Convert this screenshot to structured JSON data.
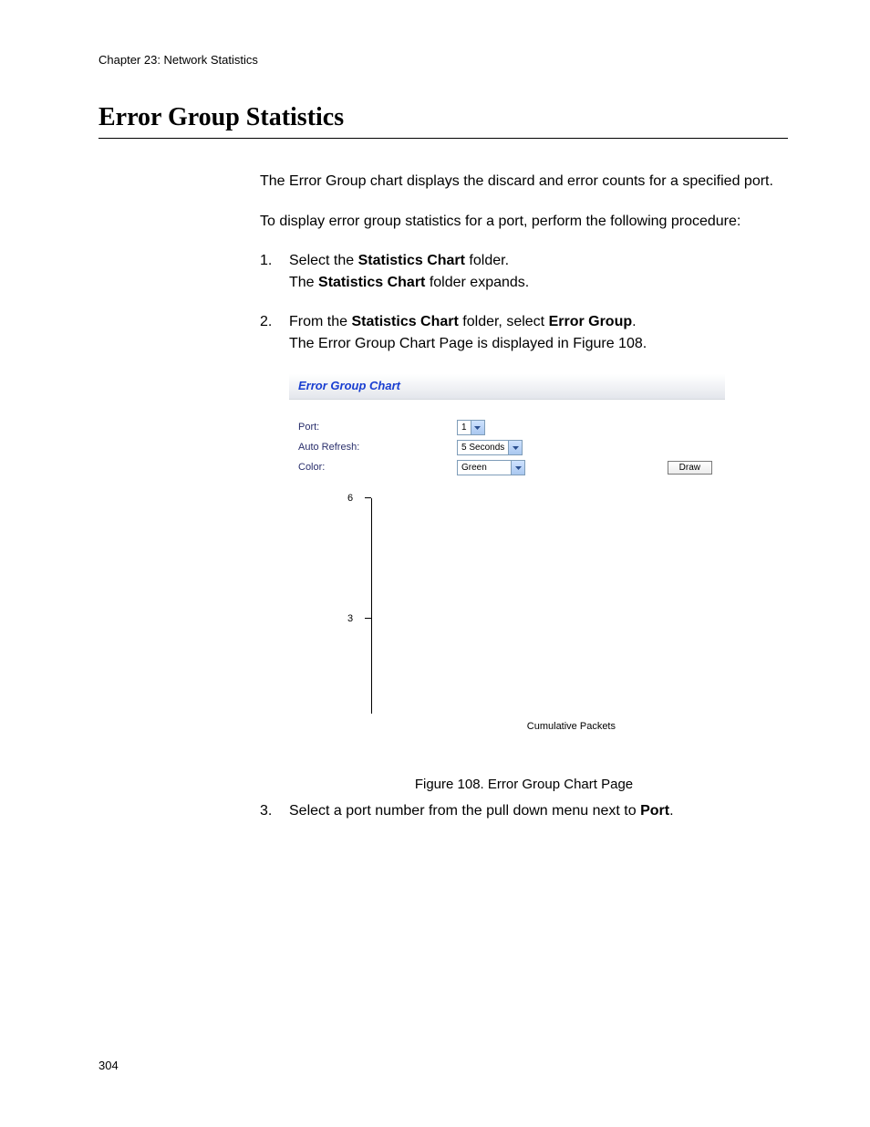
{
  "chapter_header": "Chapter 23: Network Statistics",
  "section_title": "Error Group Statistics",
  "intro_para": "The Error Group chart displays the discard and error counts for a specified port.",
  "proc_para": "To display error group statistics for a port, perform the following procedure:",
  "steps": {
    "s1": {
      "num": "1.",
      "line1_pre": "Select the ",
      "line1_bold": "Statistics Chart",
      "line1_post": " folder.",
      "line2_pre": "The ",
      "line2_bold": "Statistics Chart",
      "line2_post": " folder expands."
    },
    "s2": {
      "num": "2.",
      "line1_pre": "From the ",
      "line1_bold1": "Statistics Chart",
      "line1_mid": " folder, select ",
      "line1_bold2": "Error Group",
      "line1_post": ".",
      "line2": "The Error Group Chart Page is displayed in Figure 108."
    },
    "s3": {
      "num": "3.",
      "line1_pre": "Select a port number from the pull down menu next to ",
      "line1_bold": "Port",
      "line1_post": "."
    }
  },
  "figure": {
    "panel_title": "Error Group Chart",
    "labels": {
      "port": "Port:",
      "auto_refresh": "Auto Refresh:",
      "color": "Color:"
    },
    "controls": {
      "port_value": "1",
      "auto_refresh_value": "5 Seconds",
      "color_value": "Green",
      "draw_button": "Draw"
    },
    "caption": "Figure 108. Error Group Chart Page"
  },
  "chart_data": {
    "type": "line",
    "title": "",
    "xlabel": "Cumulative Packets",
    "ylabel": "",
    "ylim": [
      0,
      6
    ],
    "y_ticks": [
      3,
      6
    ],
    "series": []
  },
  "page_number": "304"
}
